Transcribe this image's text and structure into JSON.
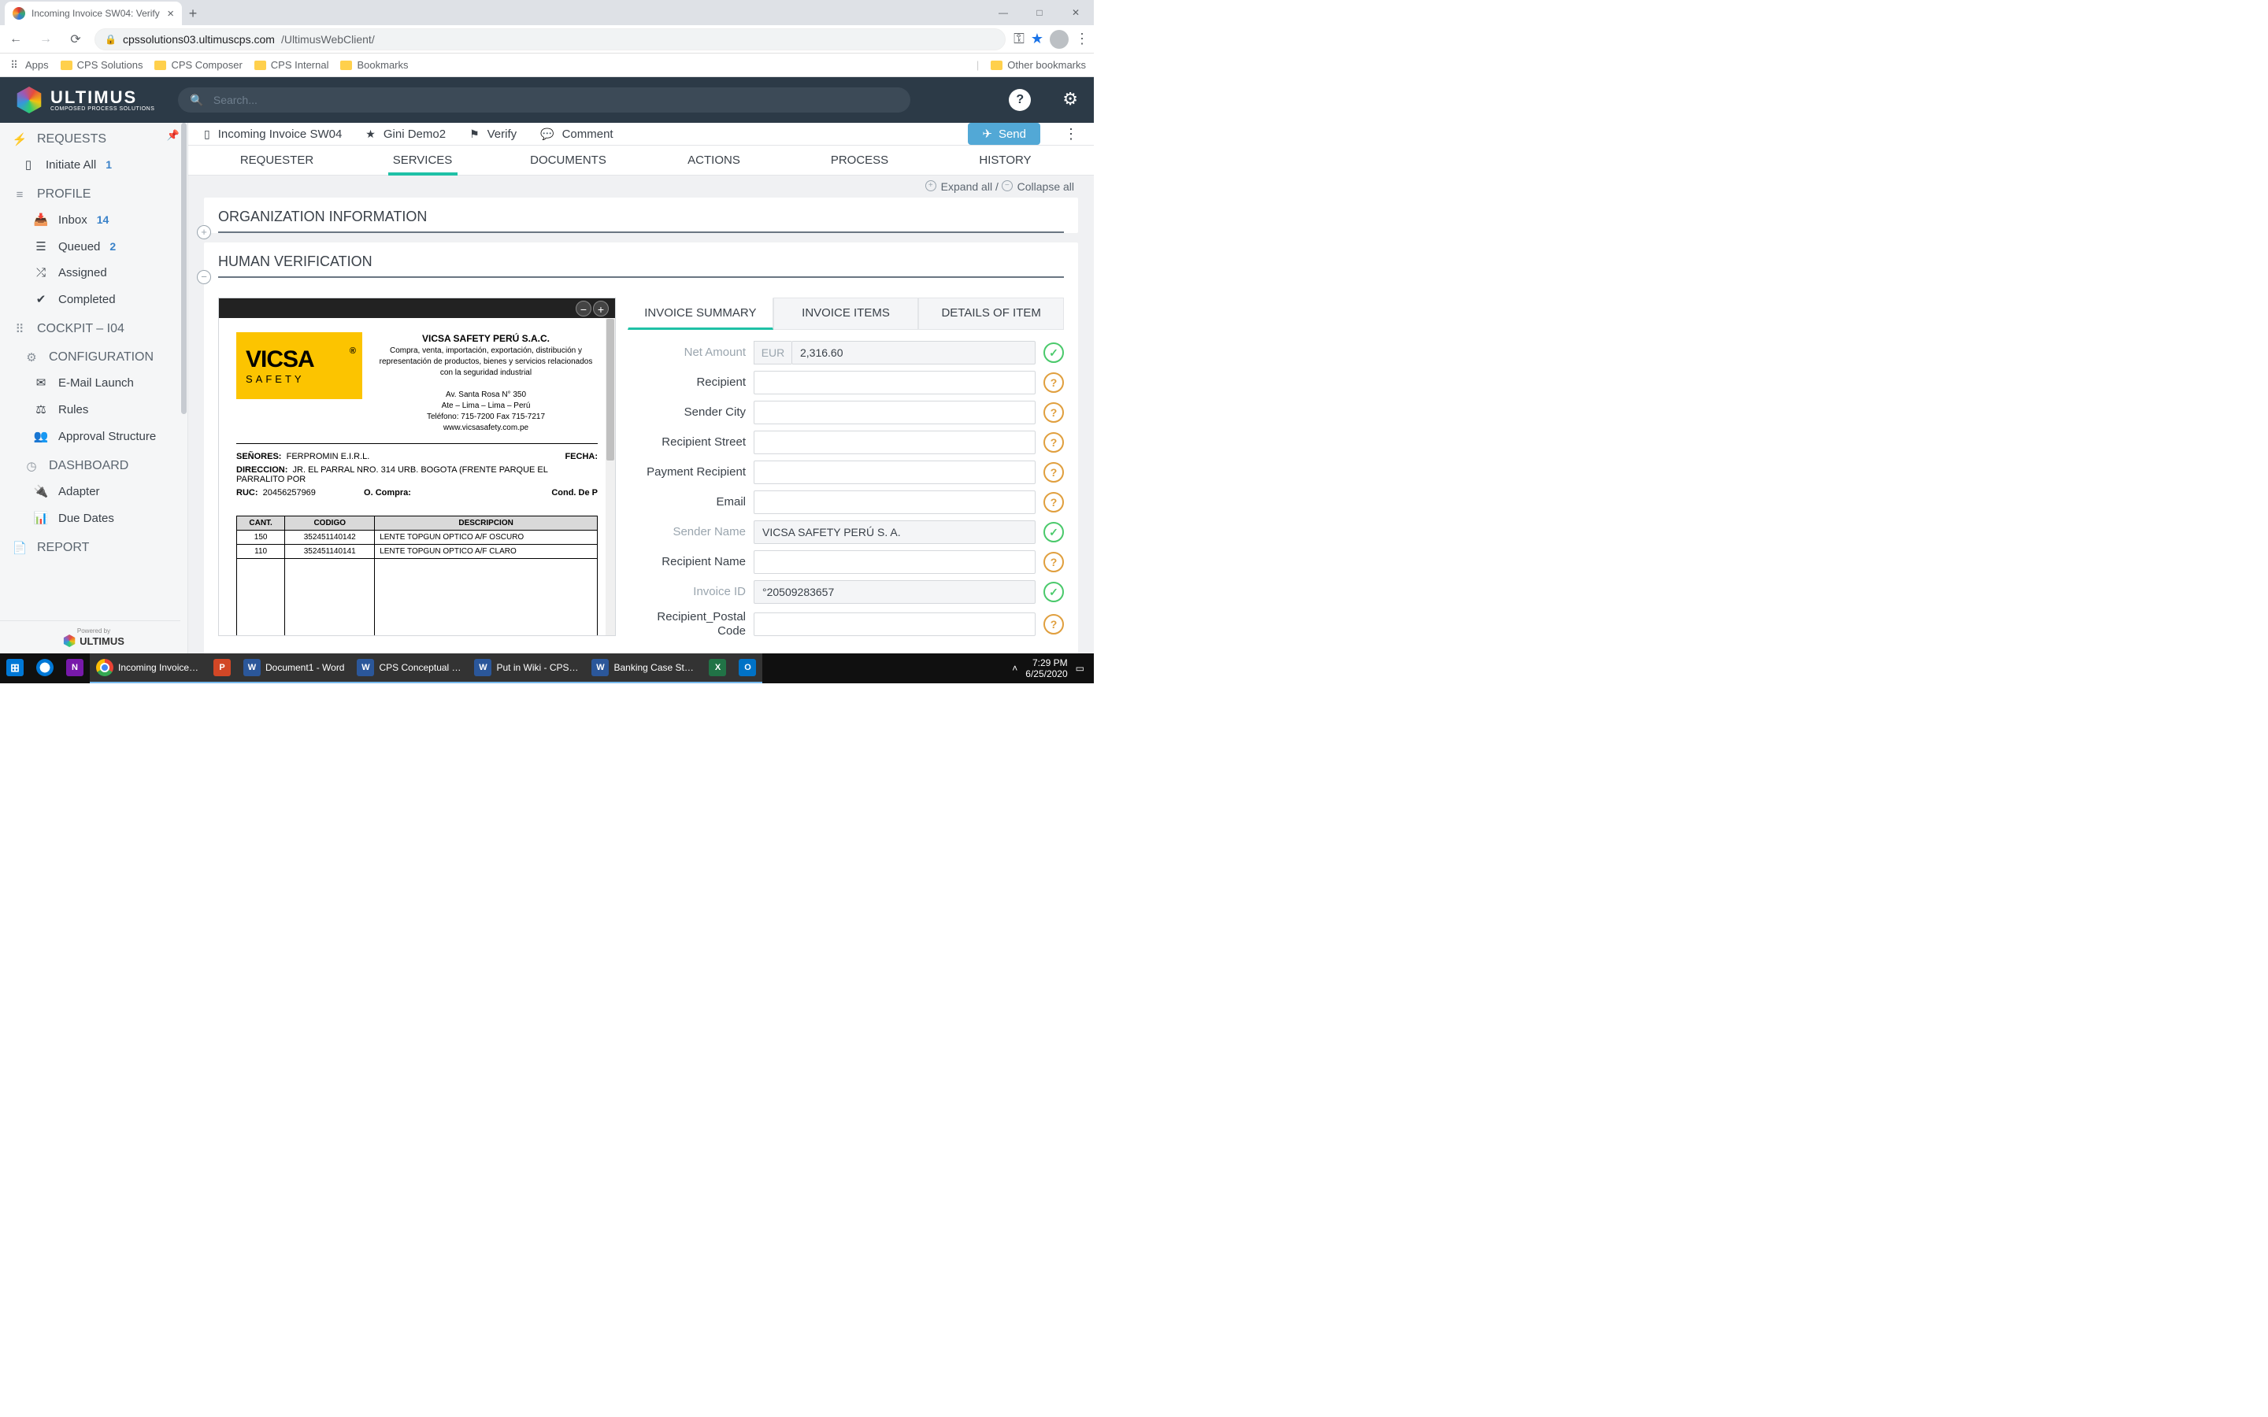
{
  "browser": {
    "tab_title": "Incoming Invoice SW04: Verify",
    "url_host": "cpssolutions03.ultimuscps.com",
    "url_path": "/UltimusWebClient/",
    "bookmarks": [
      "CPS Solutions",
      "CPS Composer",
      "CPS Internal",
      "Bookmarks"
    ],
    "apps_label": "Apps",
    "other_bookmarks": "Other bookmarks"
  },
  "header": {
    "brand": "ULTIMUS",
    "brand_sub": "COMPOSED PROCESS SOLUTIONS",
    "search_placeholder": "Search..."
  },
  "sidebar": {
    "sections": {
      "requests": "REQUESTS",
      "profile": "PROFILE",
      "cockpit": "COCKPIT – I04",
      "configuration": "CONFIGURATION",
      "dashboard": "DASHBOARD",
      "report": "REPORT"
    },
    "items": {
      "initiate_all": "Initiate All",
      "initiate_badge": "1",
      "inbox": "Inbox",
      "inbox_badge": "14",
      "queued": "Queued",
      "queued_badge": "2",
      "assigned": "Assigned",
      "completed": "Completed",
      "email_launch": "E-Mail Launch",
      "rules": "Rules",
      "approval_structure": "Approval Structure",
      "adapter": "Adapter",
      "due_dates": "Due Dates"
    },
    "footer_powered": "Powered by",
    "footer_brand": "ULTIMUS"
  },
  "crumb": {
    "title": "Incoming Invoice SW04",
    "workspace": "Gini Demo2",
    "status": "Verify",
    "comment": "Comment",
    "send": "Send"
  },
  "tabs": [
    "REQUESTER",
    "SERVICES",
    "DOCUMENTS",
    "ACTIONS",
    "PROCESS",
    "HISTORY"
  ],
  "expand": {
    "expand_all": "Expand all",
    "collapse_all": "Collapse all"
  },
  "sections": {
    "org_info": "ORGANIZATION INFORMATION",
    "human_verif": "HUMAN VERIFICATION"
  },
  "doc": {
    "company": "VICSA SAFETY PERÚ S.A.C.",
    "company_desc": "Compra, venta, importación, exportación, distribución y representación de productos, bienes y servicios relacionados con la seguridad industrial",
    "addr1": "Av. Santa Rosa N° 350",
    "addr2": "Ate – Lima – Lima – Perú",
    "addr3": "Teléfono: 715-7200 Fax 715-7217",
    "addr4": "www.vicsasafety.com.pe",
    "senores_l": "SEÑORES:",
    "senores_v": "FERPROMIN E.I.R.L.",
    "fecha_l": "FECHA:",
    "direccion_l": "DIRECCION:",
    "direccion_v": "JR. EL PARRAL NRO. 314 URB. BOGOTA (FRENTE PARQUE EL PARRALITO POR",
    "ruc_l": "RUC:",
    "ruc_v": "20456257969",
    "ocompra_l": "O. Compra:",
    "cond_l": "Cond. De P",
    "th_cant": "CANT.",
    "th_codigo": "CODIGO",
    "th_desc": "DESCRIPCION",
    "r1_cant": "150",
    "r1_cod": "352451140142",
    "r1_desc": "LENTE TOPGUN OPTICO A/F OSCURO",
    "r2_cant": "110",
    "r2_cod": "352451140141",
    "r2_desc": "LENTE TOPGUN OPTICO A/F CLARO",
    "logo_big": "VICSA",
    "logo_sub": "SAFETY"
  },
  "form_tabs": [
    "INVOICE SUMMARY",
    "INVOICE ITEMS",
    "DETAILS OF ITEM"
  ],
  "form": {
    "net_amount_l": "Net Amount",
    "net_currency": "EUR",
    "net_amount_v": "2,316.60",
    "recipient_l": "Recipient",
    "sender_city_l": "Sender City",
    "recipient_street_l": "Recipient Street",
    "payment_recipient_l": "Payment Recipient",
    "email_l": "Email",
    "sender_name_l": "Sender Name",
    "sender_name_v": "VICSA SAFETY PERÚ S. A.",
    "recipient_name_l": "Recipient Name",
    "invoice_id_l": "Invoice ID",
    "invoice_id_v": "°20509283657",
    "recipient_postal_l": "Recipient_Postal Code"
  },
  "taskbar": {
    "items": [
      "Incoming Invoice S...",
      "",
      "Document1 - Word",
      "CPS Conceptual Ov...",
      "Put in Wiki - CPS In...",
      "Banking Case Study..."
    ],
    "time": "7:29 PM",
    "date": "6/25/2020"
  }
}
